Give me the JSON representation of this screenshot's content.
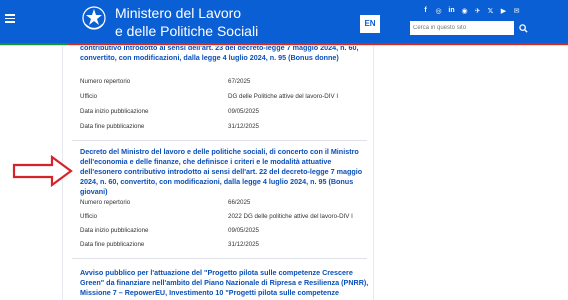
{
  "header": {
    "title_line1": "Ministero del Lavoro",
    "title_line2": "e delle Politiche Sociali",
    "lang": "EN",
    "search_placeholder": "Cerca in questo sito",
    "social": [
      "f",
      "◎",
      "in",
      "◉",
      "✈",
      "𝕏",
      "▶",
      "✉"
    ]
  },
  "items": [
    {
      "title": "contributivo introdotto ai sensi dell'art. 23 del decreto-legge 7 maggio 2024, n. 60, convertito, con modificazioni, dalla legge 4 luglio 2024, n. 95 (Bonus donne)",
      "meta": [
        {
          "label": "Numero repertorio",
          "value": "67/2025"
        },
        {
          "label": "Ufficio",
          "value": "DG delle Politiche attive del lavoro-DIV I"
        },
        {
          "label": "Data inizio pubblicazione",
          "value": "09/05/2025"
        },
        {
          "label": "Data fine pubblicazione",
          "value": "31/12/2025"
        }
      ]
    },
    {
      "title": "Decreto del Ministro del lavoro e delle politiche sociali, di concerto con il Ministro dell'economia e delle finanze, che definisce i criteri e le modalità attuative dell'esonero contributivo introdotto ai sensi dell'art. 22 del decreto-legge 7 maggio 2024, n. 60, convertito, con modificazioni, dalla legge 4 luglio 2024, n. 95 (Bonus giovani)",
      "meta": [
        {
          "label": "Numero repertorio",
          "value": "66/2025"
        },
        {
          "label": "Ufficio",
          "value": "2022 DG delle politiche attive del lavoro-DIV I"
        },
        {
          "label": "Data inizio pubblicazione",
          "value": "09/05/2025"
        },
        {
          "label": "Data fine pubblicazione",
          "value": "31/12/2025"
        }
      ]
    },
    {
      "title": "Avviso pubblico per l'attuazione del \"Progetto pilota sulle competenze Crescere Green\" da finanziare nell'ambito del Piano Nazionale di Ripresa e Resilienza (PNRR), Missione 7 – RepowerEU, Investimento 10 \"Progetti pilota sulle competenze Crescere Green\","
    }
  ]
}
